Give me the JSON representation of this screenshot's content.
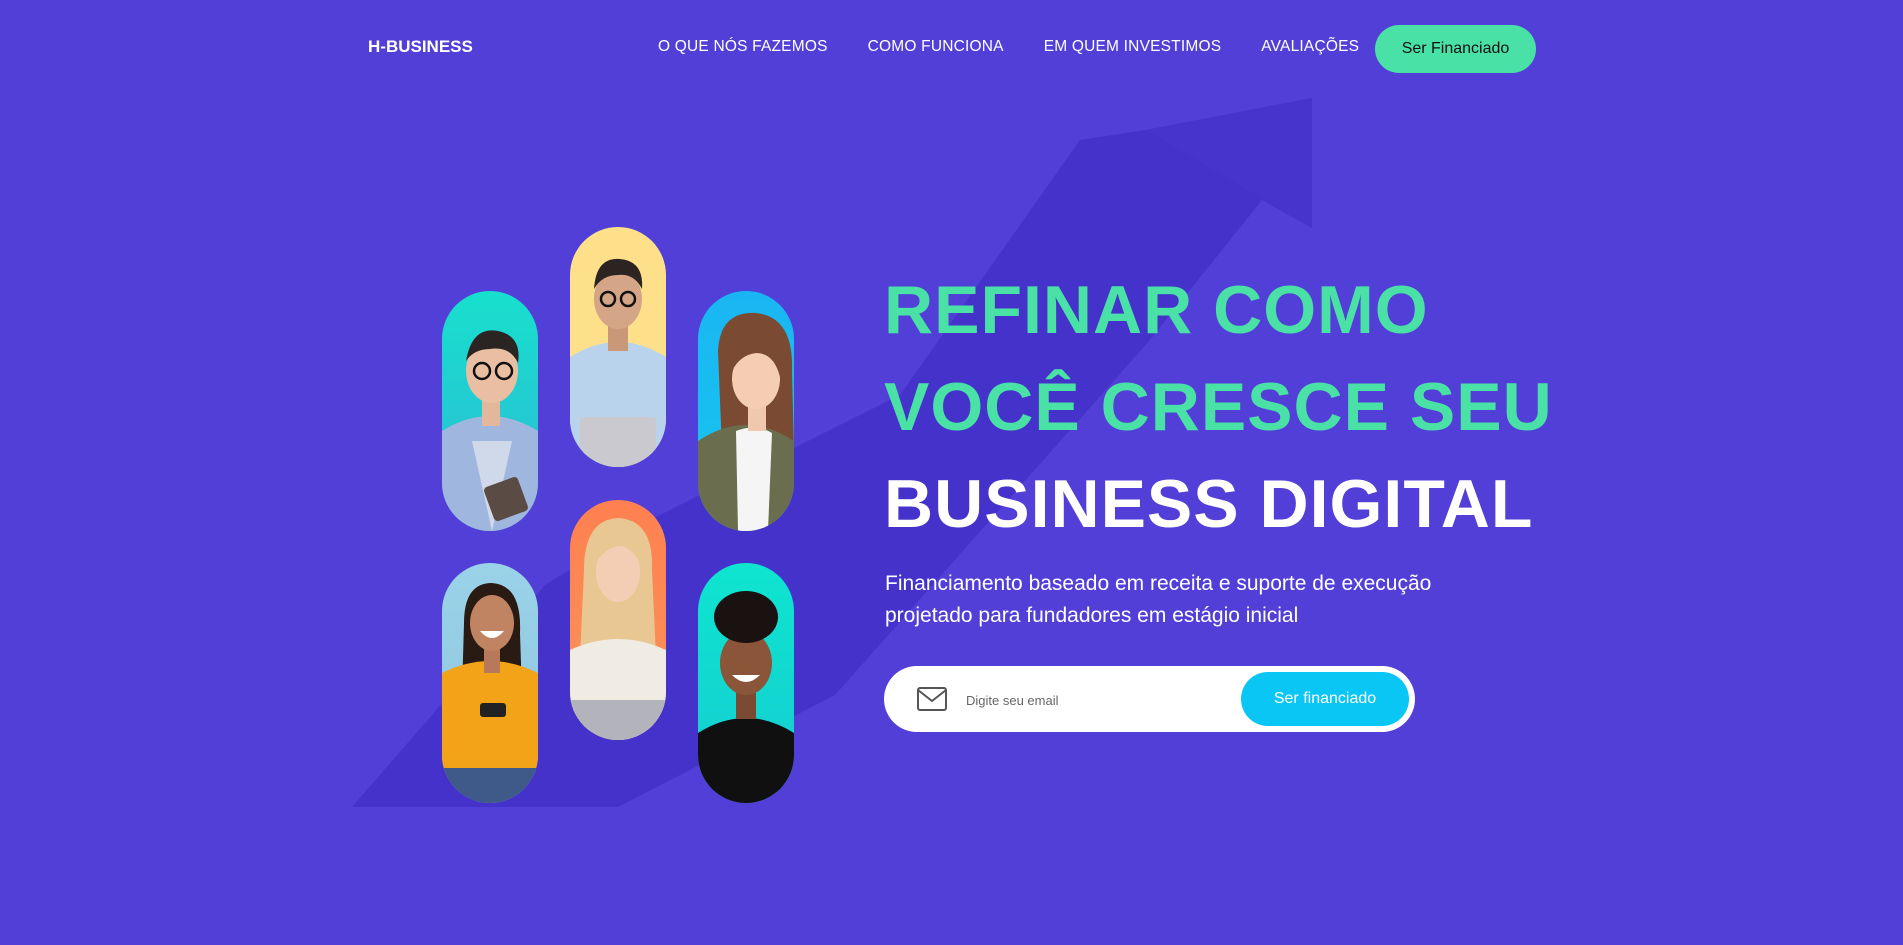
{
  "header": {
    "logo": "H-BUSINESS",
    "nav": [
      "O QUE NÓS FAZEMOS",
      "COMO FUNCIONA",
      "EM QUEM INVESTIMOS",
      "AVALIAÇÕES"
    ],
    "cta_label": "Ser Financiado"
  },
  "hero": {
    "title_line1": "REFINAR COMO",
    "title_line2": "VOCÊ CRESCE SEU",
    "title_line3": "BUSINESS DIGITAL",
    "subtitle": "Financiamento baseado em receita e suporte de execução projetado para fundadores em estágio inicial",
    "email_placeholder": "Digite seu email",
    "submit_label": "Ser financiado"
  },
  "colors": {
    "background": "#523fd7",
    "accent_green": "#4ae1a6",
    "accent_cyan": "#09c6f4"
  },
  "icons": [
    "mail-icon",
    "growth-arrow-graphic"
  ],
  "photos": [
    "person-smiling-with-tablet",
    "man-with-glasses-and-laptop",
    "woman-in-olive-jacket",
    "woman-laughing-with-phone",
    "blonde-woman-with-laptop",
    "man-with-curly-hair-smiling"
  ]
}
